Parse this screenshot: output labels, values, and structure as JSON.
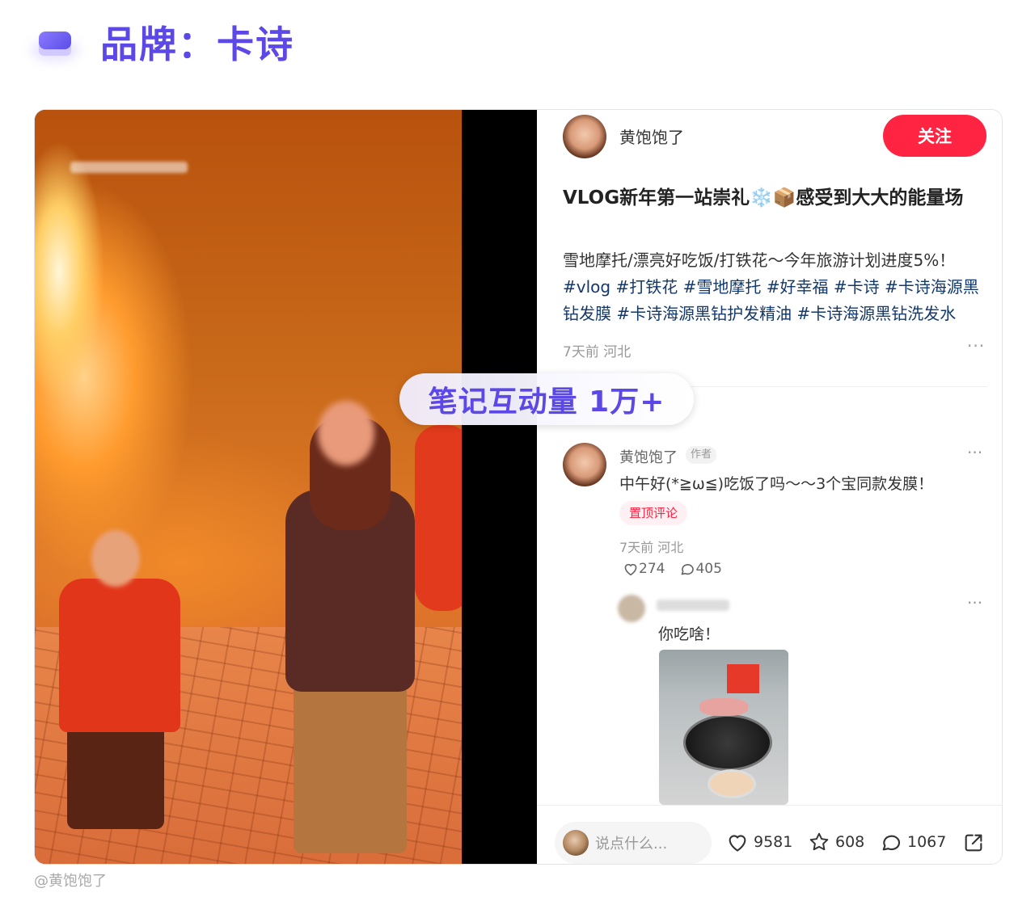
{
  "header": {
    "title": "品牌：卡诗",
    "icon": "layers-icon"
  },
  "note": {
    "author_name": "黄饱饱了",
    "follow_label": "关注",
    "title": "VLOG新年第一站崇礼❄️📦感受到大大的能量场",
    "desc_text": "雪地摩托/漂亮好吃饭/打铁花～今年旅游计划进度5%！",
    "tags": [
      "#vlog",
      "#打铁花",
      "#雪地摩托",
      "#好幸福",
      "#卡诗",
      "#卡诗海源黑钻发膜",
      "#卡诗海源黑钻护发精油",
      "#卡诗海源黑钻洗发水"
    ],
    "meta": "7天前 河北",
    "more": "···"
  },
  "comment": {
    "name": "黄饱饱了",
    "author_tag": "作者",
    "text": "中午好(*≧ω≦)吃饭了吗～～3个宝同款发膜！",
    "pin_label": "置顶评论",
    "meta": "7天前 河北",
    "likes": "274",
    "replies": "405",
    "more": "···"
  },
  "reply": {
    "text": "你吃啥！",
    "more": "···"
  },
  "bottom_bar": {
    "input_placeholder": "说点什么...",
    "likes": "9581",
    "favorites": "608",
    "comments": "1067"
  },
  "overlay": {
    "label": "笔记互动量 1万+"
  },
  "credit": "@黄饱饱了",
  "colors": {
    "accent": "#5b48e6",
    "follow": "#ff2442",
    "tag": "#13386c"
  }
}
